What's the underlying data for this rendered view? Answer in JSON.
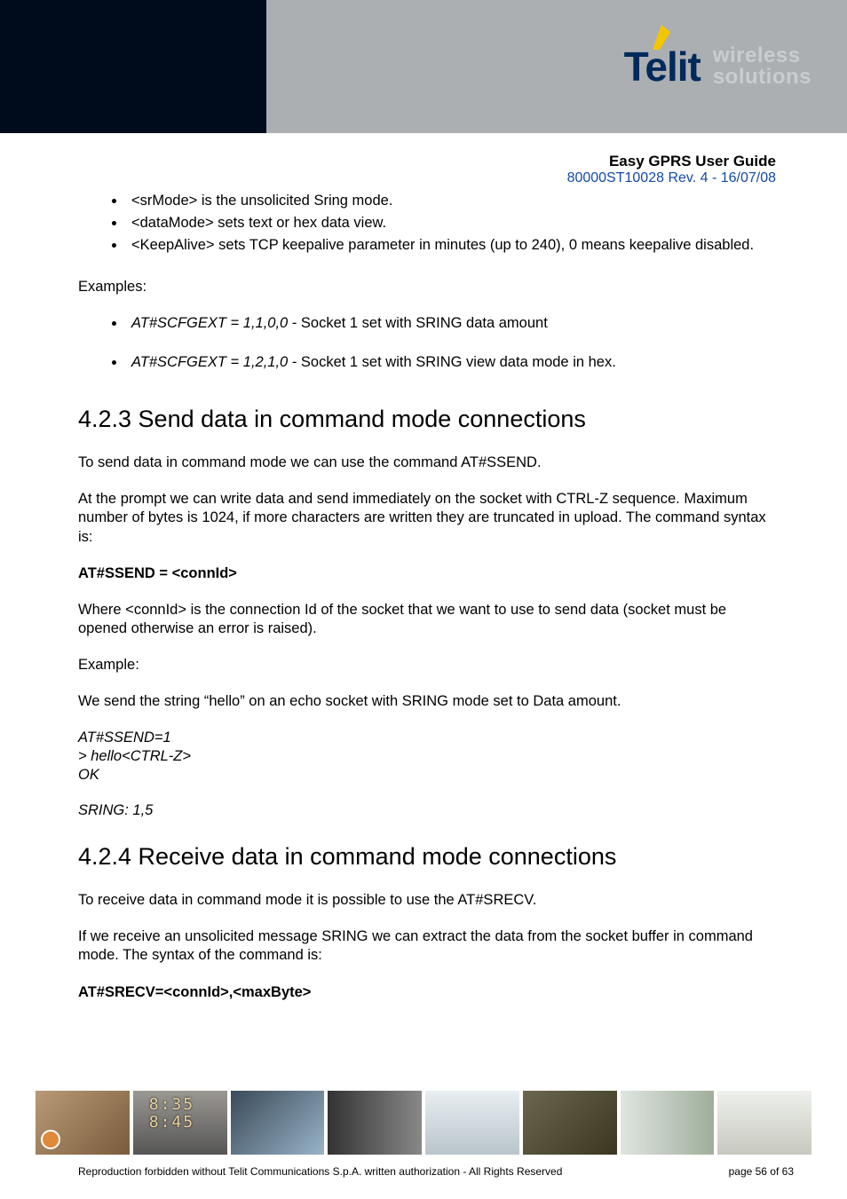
{
  "header": {
    "brand_main": "Telit",
    "brand_sub1": "wireless",
    "brand_sub2": "solutions"
  },
  "meta": {
    "title": "Easy GPRS User Guide",
    "revision": "80000ST10028 Rev. 4 - 16/07/08"
  },
  "intro_bullets": [
    "<srMode> is the unsolicited Sring mode.",
    "<dataMode> sets text or hex data view.",
    "<KeepAlive> sets TCP keepalive parameter in minutes (up to 240), 0 means keepalive disabled."
  ],
  "examples_label": "Examples:",
  "examples": [
    {
      "cmd": "AT#SCFGEXT = 1,1,0,0 ",
      "desc": " - Socket 1 set with SRING data amount"
    },
    {
      "cmd": "AT#SCFGEXT = 1,2,1,0 ",
      "desc": " - Socket 1 set with SRING view data mode in hex."
    }
  ],
  "section_423": {
    "heading": "4.2.3 Send data in command mode connections",
    "p1": "To send data in command mode we can use the command AT#SSEND.",
    "p2": "At the prompt we can write data and send immediately on the socket with CTRL-Z sequence. Maximum number of bytes is 1024, if more characters are written they are truncated in upload. The command syntax is:",
    "cmd_bold": "AT#SSEND = <connId>",
    "p3": "Where <connId> is the connection Id of the socket that we want to use to send data (socket must be opened otherwise an error is raised).",
    "example_label": "Example:",
    "example_desc": "We send the string “hello” on an echo socket with SRING mode set to Data amount.",
    "code": [
      "AT#SSEND=1",
      "> hello<CTRL-Z>",
      "OK"
    ],
    "sring": "SRING: 1,5"
  },
  "section_424": {
    "heading": "4.2.4 Receive data in command mode connections",
    "p1": "To receive data in command mode it is possible to use the AT#SRECV.",
    "p2": "If we receive an unsolicited message SRING we can extract the data from the socket buffer in command mode. The syntax of the command is:",
    "cmd_bold": "AT#SRECV=<connId>,<maxByte>"
  },
  "footer": {
    "copyright": "Reproduction forbidden without Telit Communications S.p.A. written authorization - All Rights Reserved",
    "page": "page 56 of 63"
  },
  "thumb_digits": [
    "8:35",
    "8:45"
  ]
}
